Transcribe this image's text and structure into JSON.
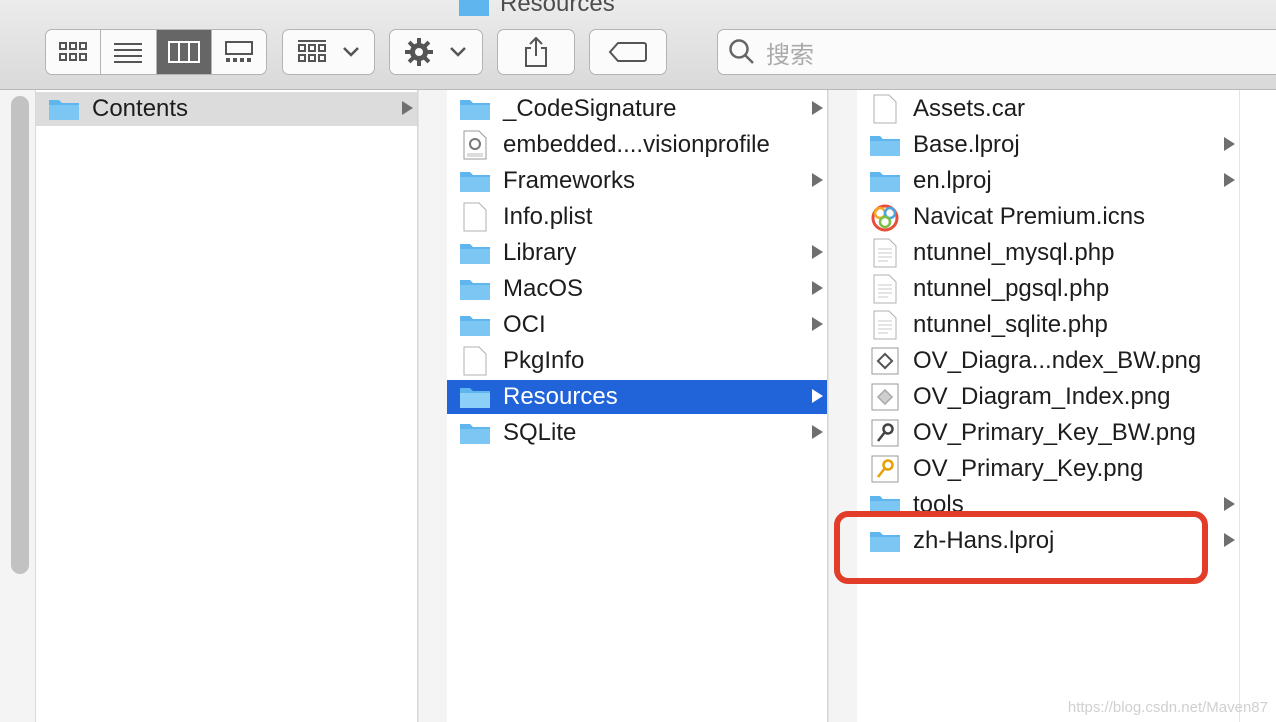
{
  "window": {
    "title": "Resources"
  },
  "toolbar": {
    "view_buttons": [
      "icon-view-icon",
      "list-view-icon",
      "column-view-icon",
      "gallery-view-icon"
    ],
    "active_view": "column-view-icon",
    "group_icon": "group-grid-icon",
    "action_icon": "gear-icon",
    "share_icon": "share-icon",
    "tag_icon": "tag-icon"
  },
  "search": {
    "placeholder": "搜索"
  },
  "columns": [
    {
      "items": [
        {
          "label": "Contents",
          "icon": "folder-icon",
          "arrow": true,
          "state": "selected-inactive"
        }
      ]
    },
    {
      "items": [
        {
          "label": "_CodeSignature",
          "icon": "folder-icon",
          "arrow": true
        },
        {
          "label": "embedded....visionprofile",
          "icon": "provision-file-icon",
          "arrow": false
        },
        {
          "label": "Frameworks",
          "icon": "folder-icon",
          "arrow": true
        },
        {
          "label": "Info.plist",
          "icon": "file-icon",
          "arrow": false
        },
        {
          "label": "Library",
          "icon": "folder-icon",
          "arrow": true
        },
        {
          "label": "MacOS",
          "icon": "folder-icon",
          "arrow": true
        },
        {
          "label": "OCI",
          "icon": "folder-icon",
          "arrow": true
        },
        {
          "label": "PkgInfo",
          "icon": "file-icon",
          "arrow": false
        },
        {
          "label": "Resources",
          "icon": "folder-icon",
          "arrow": true,
          "state": "selected"
        },
        {
          "label": "SQLite",
          "icon": "folder-icon",
          "arrow": true
        }
      ]
    },
    {
      "items": [
        {
          "label": "Assets.car",
          "icon": "file-icon",
          "arrow": false
        },
        {
          "label": "Base.lproj",
          "icon": "folder-icon",
          "arrow": true
        },
        {
          "label": "en.lproj",
          "icon": "folder-icon",
          "arrow": true
        },
        {
          "label": "Navicat Premium.icns",
          "icon": "navicat-app-icon",
          "arrow": false
        },
        {
          "label": "ntunnel_mysql.php",
          "icon": "text-file-icon",
          "arrow": false
        },
        {
          "label": "ntunnel_pgsql.php",
          "icon": "text-file-icon",
          "arrow": false
        },
        {
          "label": "ntunnel_sqlite.php",
          "icon": "text-file-icon",
          "arrow": false
        },
        {
          "label": "OV_Diagra...ndex_BW.png",
          "icon": "diagram-image-icon",
          "arrow": false
        },
        {
          "label": "OV_Diagram_Index.png",
          "icon": "diagram-image-icon",
          "arrow": false
        },
        {
          "label": "OV_Primary_Key_BW.png",
          "icon": "key-image-icon",
          "arrow": false
        },
        {
          "label": "OV_Primary_Key.png",
          "icon": "key-color-image-icon",
          "arrow": false
        },
        {
          "label": "tools",
          "icon": "folder-icon",
          "arrow": true
        },
        {
          "label": "zh-Hans.lproj",
          "icon": "folder-icon",
          "arrow": true,
          "state": "highlighted"
        }
      ]
    }
  ],
  "annotation": {
    "color": "#e23d28",
    "target": "zh-Hans.lproj"
  },
  "colors": {
    "selection": "#2163d9",
    "folder": "#5fb6ee"
  },
  "watermark": "https://blog.csdn.net/Maven87"
}
